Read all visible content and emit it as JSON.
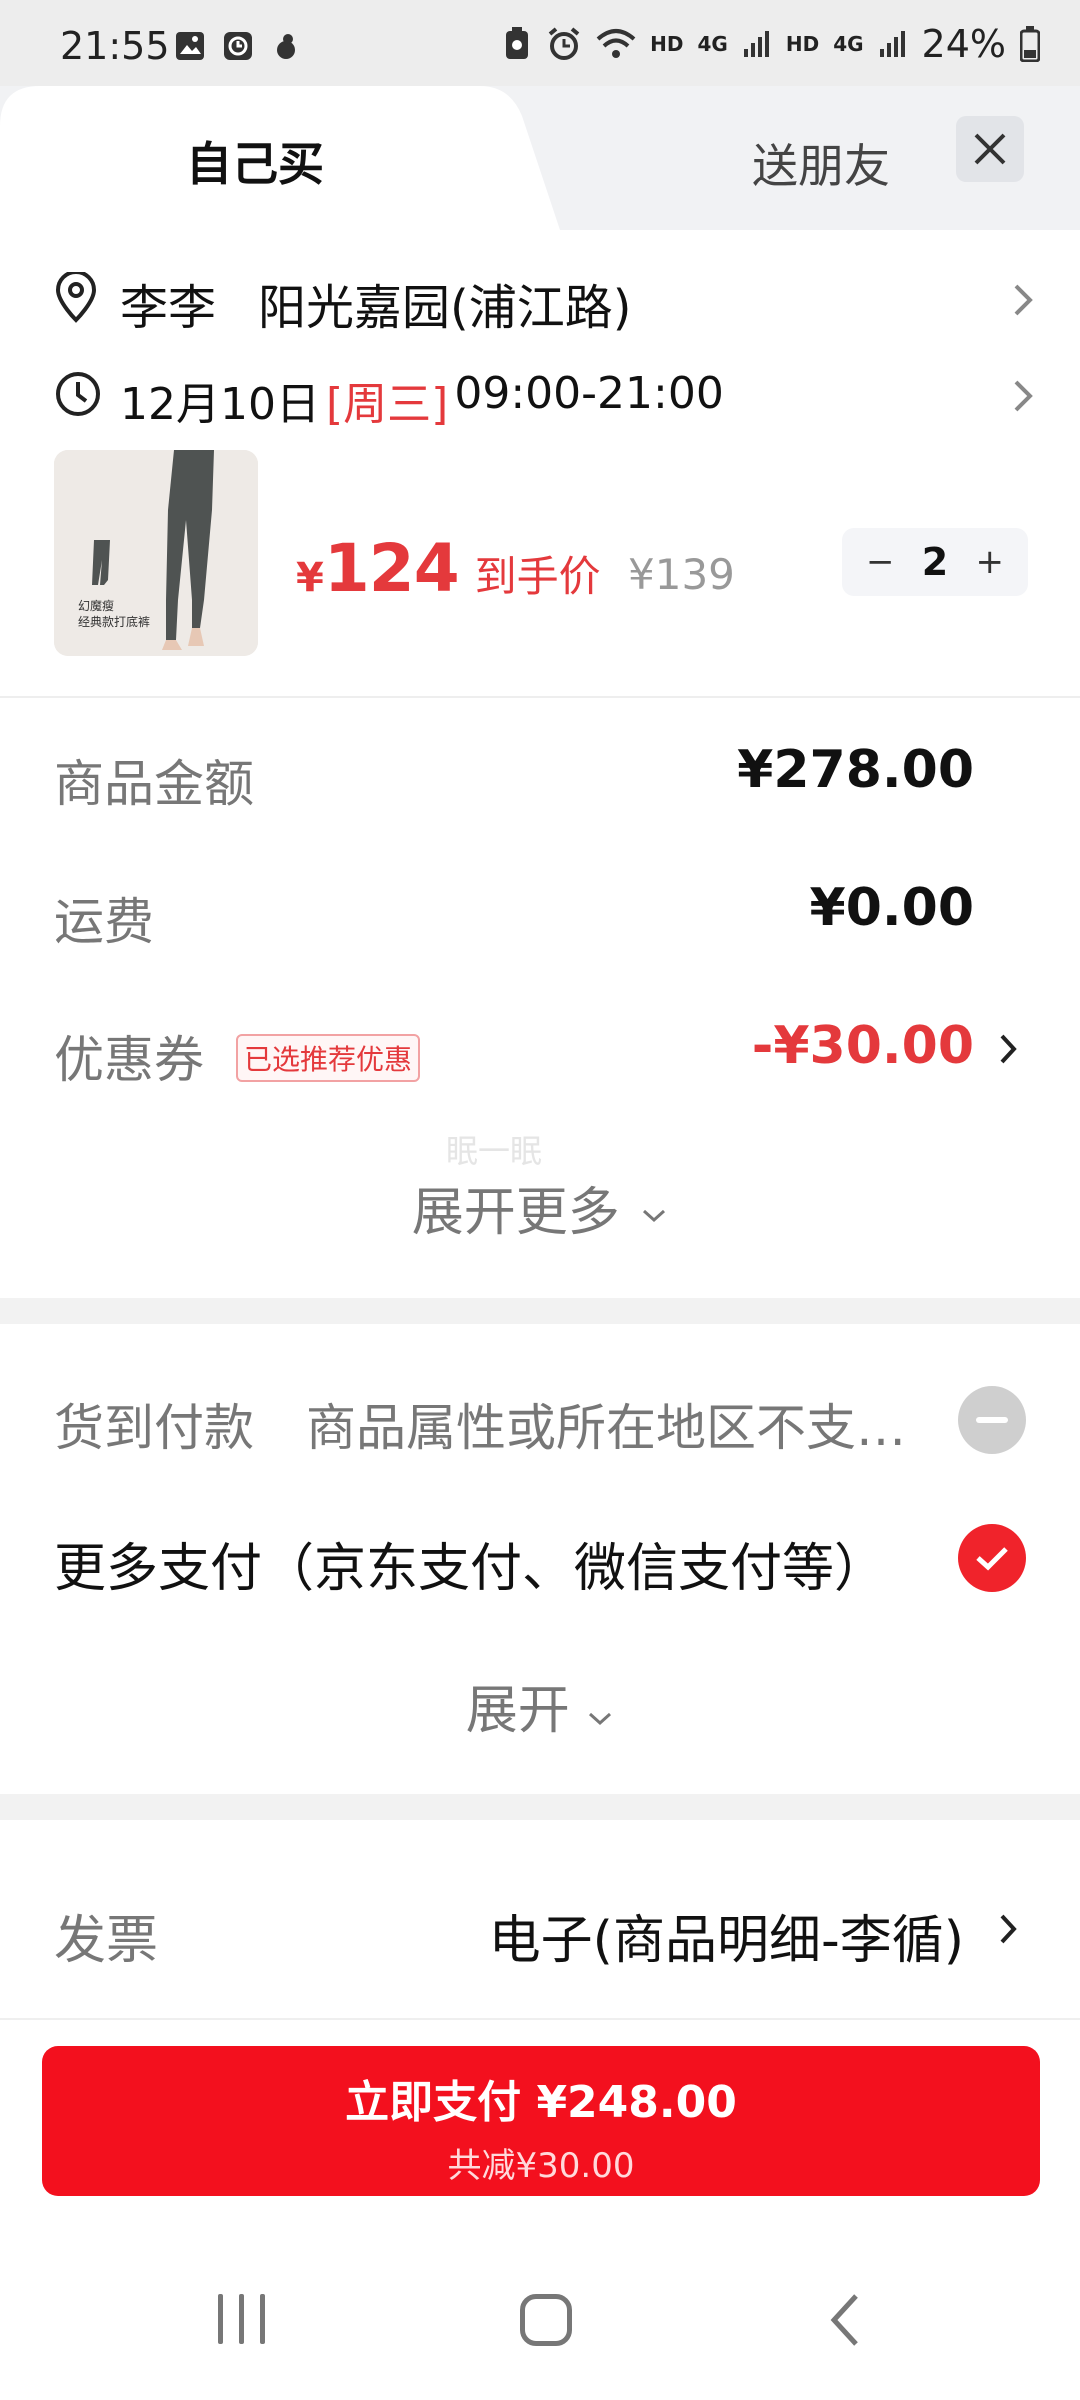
{
  "status_bar": {
    "time": "21:55",
    "network_1": "HD",
    "network_2": "4G",
    "network_3": "HD",
    "network_4": "4G",
    "battery": "24%"
  },
  "tabs": {
    "self_buy": "自己买",
    "send_friend": "送朋友"
  },
  "address": {
    "name": "李李",
    "location": "阳光嘉园(浦江路)"
  },
  "delivery": {
    "date": "12月10日",
    "weekday": "[周三]",
    "window": "09:00-21:00"
  },
  "product": {
    "thumb_caption_1": "幻魔瘦",
    "thumb_caption_2": "经典款打底裤",
    "price_currency": "¥",
    "price": "124",
    "price_label": "到手价",
    "original_price": "¥139",
    "quantity": "2",
    "minus": "−",
    "plus": "+"
  },
  "fees": {
    "goods_label": "商品金额",
    "goods_value": "¥278.00",
    "shipping_label": "运费",
    "shipping_value": "¥0.00",
    "coupon_label": "优惠券",
    "coupon_badge": "已选推荐优惠",
    "coupon_value": "-¥30.00",
    "watermark": "眠一眠",
    "expand_more": "展开更多"
  },
  "payment": {
    "cod_label": "货到付款",
    "cod_desc": "商品属性或所在地区不支持货到付款",
    "more_label": "更多支付（京东支付、微信支付等）",
    "expand": "展开"
  },
  "invoice": {
    "label": "发票",
    "value": "电子(商品明细-李循)"
  },
  "pay_button": {
    "label": "立即支付 ¥248.00",
    "sub": "共减¥30.00"
  },
  "colors": {
    "accent_red": "#e4393c",
    "button_red": "#f3101e"
  }
}
